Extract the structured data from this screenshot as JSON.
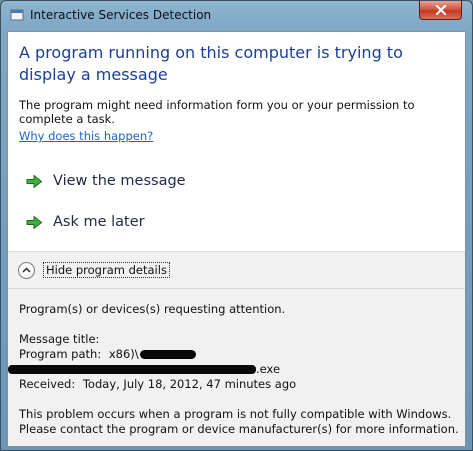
{
  "window": {
    "title": "Interactive Services Detection",
    "close_icon": "close-icon"
  },
  "main": {
    "heading": "A program running on this computer is trying to display a message",
    "intro": "The program might need information form you or your permission to complete a task.",
    "why_link": "Why does this happen?"
  },
  "commands": {
    "view": "View the message",
    "later": "Ask me later"
  },
  "details": {
    "toggle_label": "Hide program details",
    "requesting": "Program(s) or devices(s) requesting attention.",
    "message_title_label": "Message title:",
    "program_path_label": "Program path:",
    "program_path_value": "x86)\\",
    "program_path_suffix": ".exe",
    "received_label": "Received:",
    "received_value": "Today, July 18, 2012, 47 minutes ago",
    "compat_line1": "This problem occurs when a program is not fully compatible with Windows.",
    "compat_line2": "Please contact the program or device manufacturer(s) for more information."
  }
}
